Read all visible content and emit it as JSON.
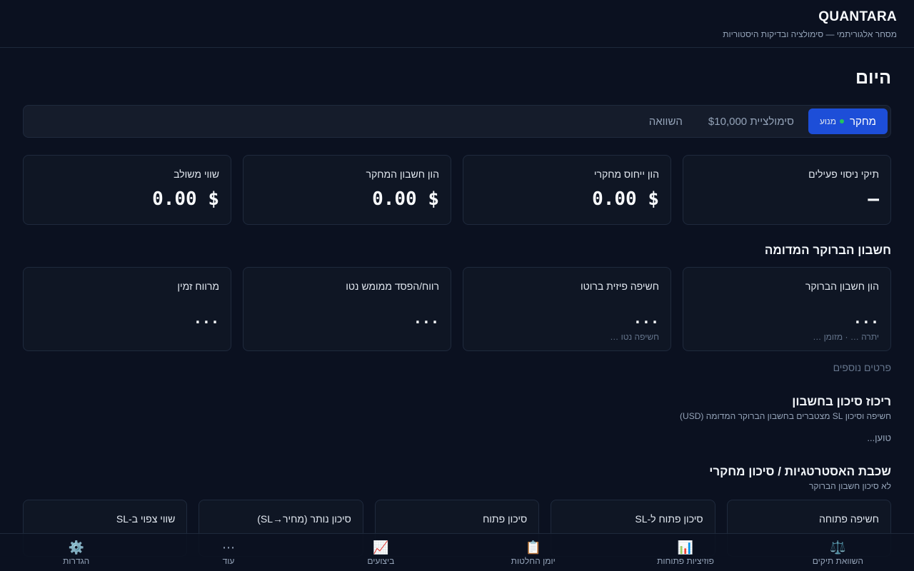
{
  "header": {
    "brand": "QUANTARA",
    "tagline": "מסחר אלגוריתמי — סימולציה ובדיקות היסטוריות"
  },
  "page": {
    "title": "היום"
  },
  "modes": {
    "research": "מחקר",
    "engine": "מנוע",
    "simulation": "סימולציית $10,000",
    "compare": "השוואה"
  },
  "summary": [
    {
      "label": "תיקי ניסוי פעילים",
      "value": "—"
    },
    {
      "label": "הון ייחוס מחקרי",
      "value": "$ 0.00"
    },
    {
      "label": "הון חשבון המחקר",
      "value": "$ 0.00"
    },
    {
      "label": "שווי משולב",
      "value": "$ 0.00"
    }
  ],
  "broker": {
    "title": "חשבון הברוקר המדומה",
    "cards": [
      {
        "label": "הון חשבון הברוקר",
        "value": "...",
        "sub": "יתרה … · מזומן …"
      },
      {
        "label": "חשיפה פיזית ברוטו",
        "value": "...",
        "sub": "חשיפה נטו …"
      },
      {
        "label": "רווח/הפסד ממומש נטו",
        "value": "...",
        "sub": ""
      },
      {
        "label": "מרווח זמין",
        "value": "...",
        "sub": ""
      }
    ],
    "more": "פרטים נוספים"
  },
  "risk": {
    "title": "ריכוז סיכון בחשבון",
    "subtitle": "חשיפה וסיכון SL מצטברים בחשבון הברוקר המדומה (USD)",
    "loading": "טוען..."
  },
  "strategy": {
    "title": "שכבת האסטרטגיות / סיכון מחקרי",
    "subtitle": "לא סיכון חשבון הברוקר",
    "cards": [
      {
        "label": "חשיפה פתוחה"
      },
      {
        "label": "סיכון פתוח ל-SL"
      },
      {
        "label": "סיכון פתוח"
      },
      {
        "label": "סיכון נותר (מחיר→SL)"
      },
      {
        "label": "שווי צפוי ב-SL"
      }
    ]
  },
  "nav": [
    {
      "label": "השוואת תיקים",
      "icon": "⚖️"
    },
    {
      "label": "פוזיציות פתוחות",
      "icon": "📊"
    },
    {
      "label": "יומן החלטות",
      "icon": "📋"
    },
    {
      "label": "ביצועים",
      "icon": "📈"
    },
    {
      "label": "עוד",
      "icon": "⋯"
    },
    {
      "label": "הגדרות",
      "icon": "⚙️"
    }
  ]
}
